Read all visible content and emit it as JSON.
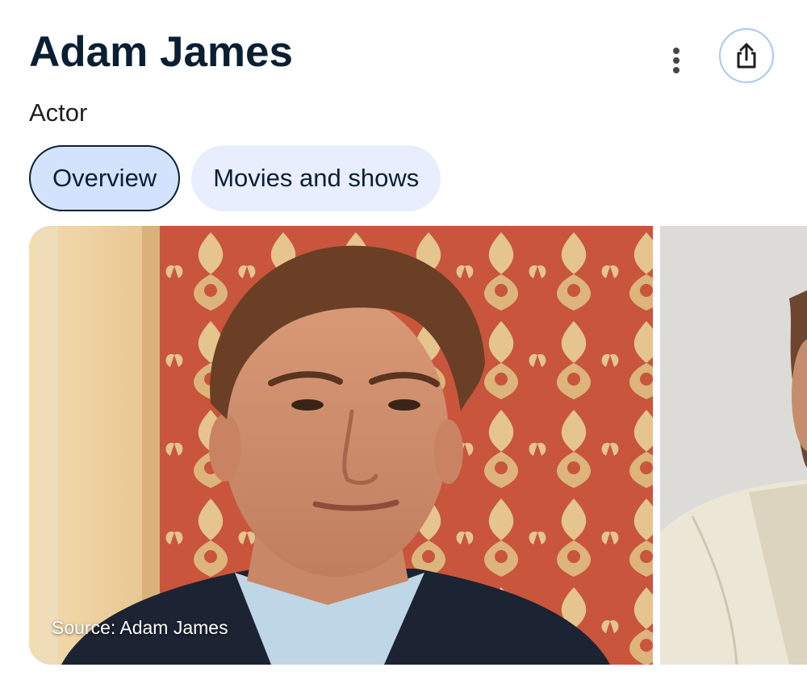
{
  "header": {
    "title": "Adam James",
    "subtitle": "Actor"
  },
  "actions": {
    "more_icon": "more-vert-icon",
    "share_icon": "share-icon",
    "share_border_color": "#a8c7fa"
  },
  "tabs": [
    {
      "label": "Overview",
      "active": true
    },
    {
      "label": "Movies and shows",
      "active": false
    }
  ],
  "images": [
    {
      "source_text": "Source: Adam James"
    }
  ],
  "colors": {
    "title": "#0b1f33",
    "tab_bg": "#e8eefd",
    "tab_active_bg": "#d3e3fd"
  }
}
